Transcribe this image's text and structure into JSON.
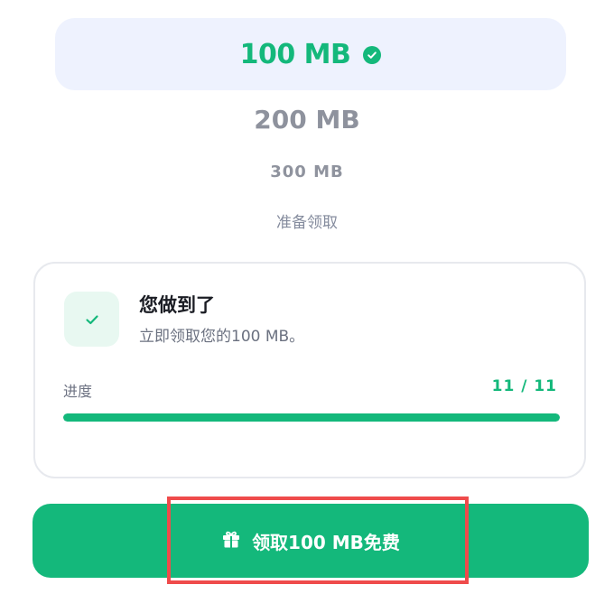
{
  "tiers": {
    "selected_label": "100 MB",
    "tier_200": "200 MB",
    "tier_300": "300 MB",
    "ready_text": "准备领取"
  },
  "card": {
    "title": "您做到了",
    "subtitle": "立即领取您的100 MB。",
    "progress_label": "进度",
    "progress_count": "11 / 11",
    "progress_fraction": 1.0
  },
  "claim_button": {
    "label": "领取100 MB免费"
  },
  "colors": {
    "accent_green": "#14b87b",
    "selected_bg": "#eef2fe",
    "highlight_red": "#ef4b4b"
  },
  "icons": {
    "selected_check": "check-circle-icon",
    "card_check": "check-icon",
    "button_icon": "gift-icon"
  }
}
